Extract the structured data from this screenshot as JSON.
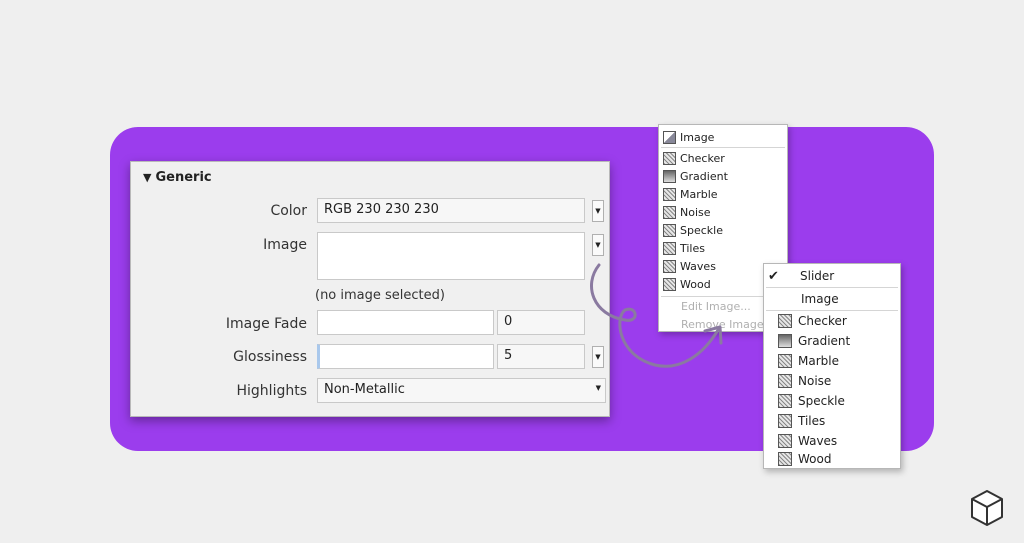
{
  "panel": {
    "header": "Generic",
    "color_label": "Color",
    "color_value": "RGB 230 230 230",
    "image_label": "Image",
    "image_note": "(no image selected)",
    "fade_label": "Image Fade",
    "fade_value": "0",
    "gloss_label": "Glossiness",
    "gloss_value": "5",
    "highlights_label": "Highlights",
    "highlights_value": "Non-Metallic"
  },
  "menu1": {
    "header": "Image",
    "items": [
      "Checker",
      "Gradient",
      "Marble",
      "Noise",
      "Speckle",
      "Tiles",
      "Waves",
      "Wood"
    ],
    "edit": "Edit Image...",
    "remove": "Remove Image"
  },
  "menu2": {
    "checked": "Slider",
    "image": "Image",
    "items": [
      "Checker",
      "Gradient",
      "Marble",
      "Noise",
      "Speckle",
      "Tiles",
      "Waves",
      "Wood"
    ]
  },
  "colors": {
    "accent": "#9b3ded",
    "background": "#efefef"
  }
}
